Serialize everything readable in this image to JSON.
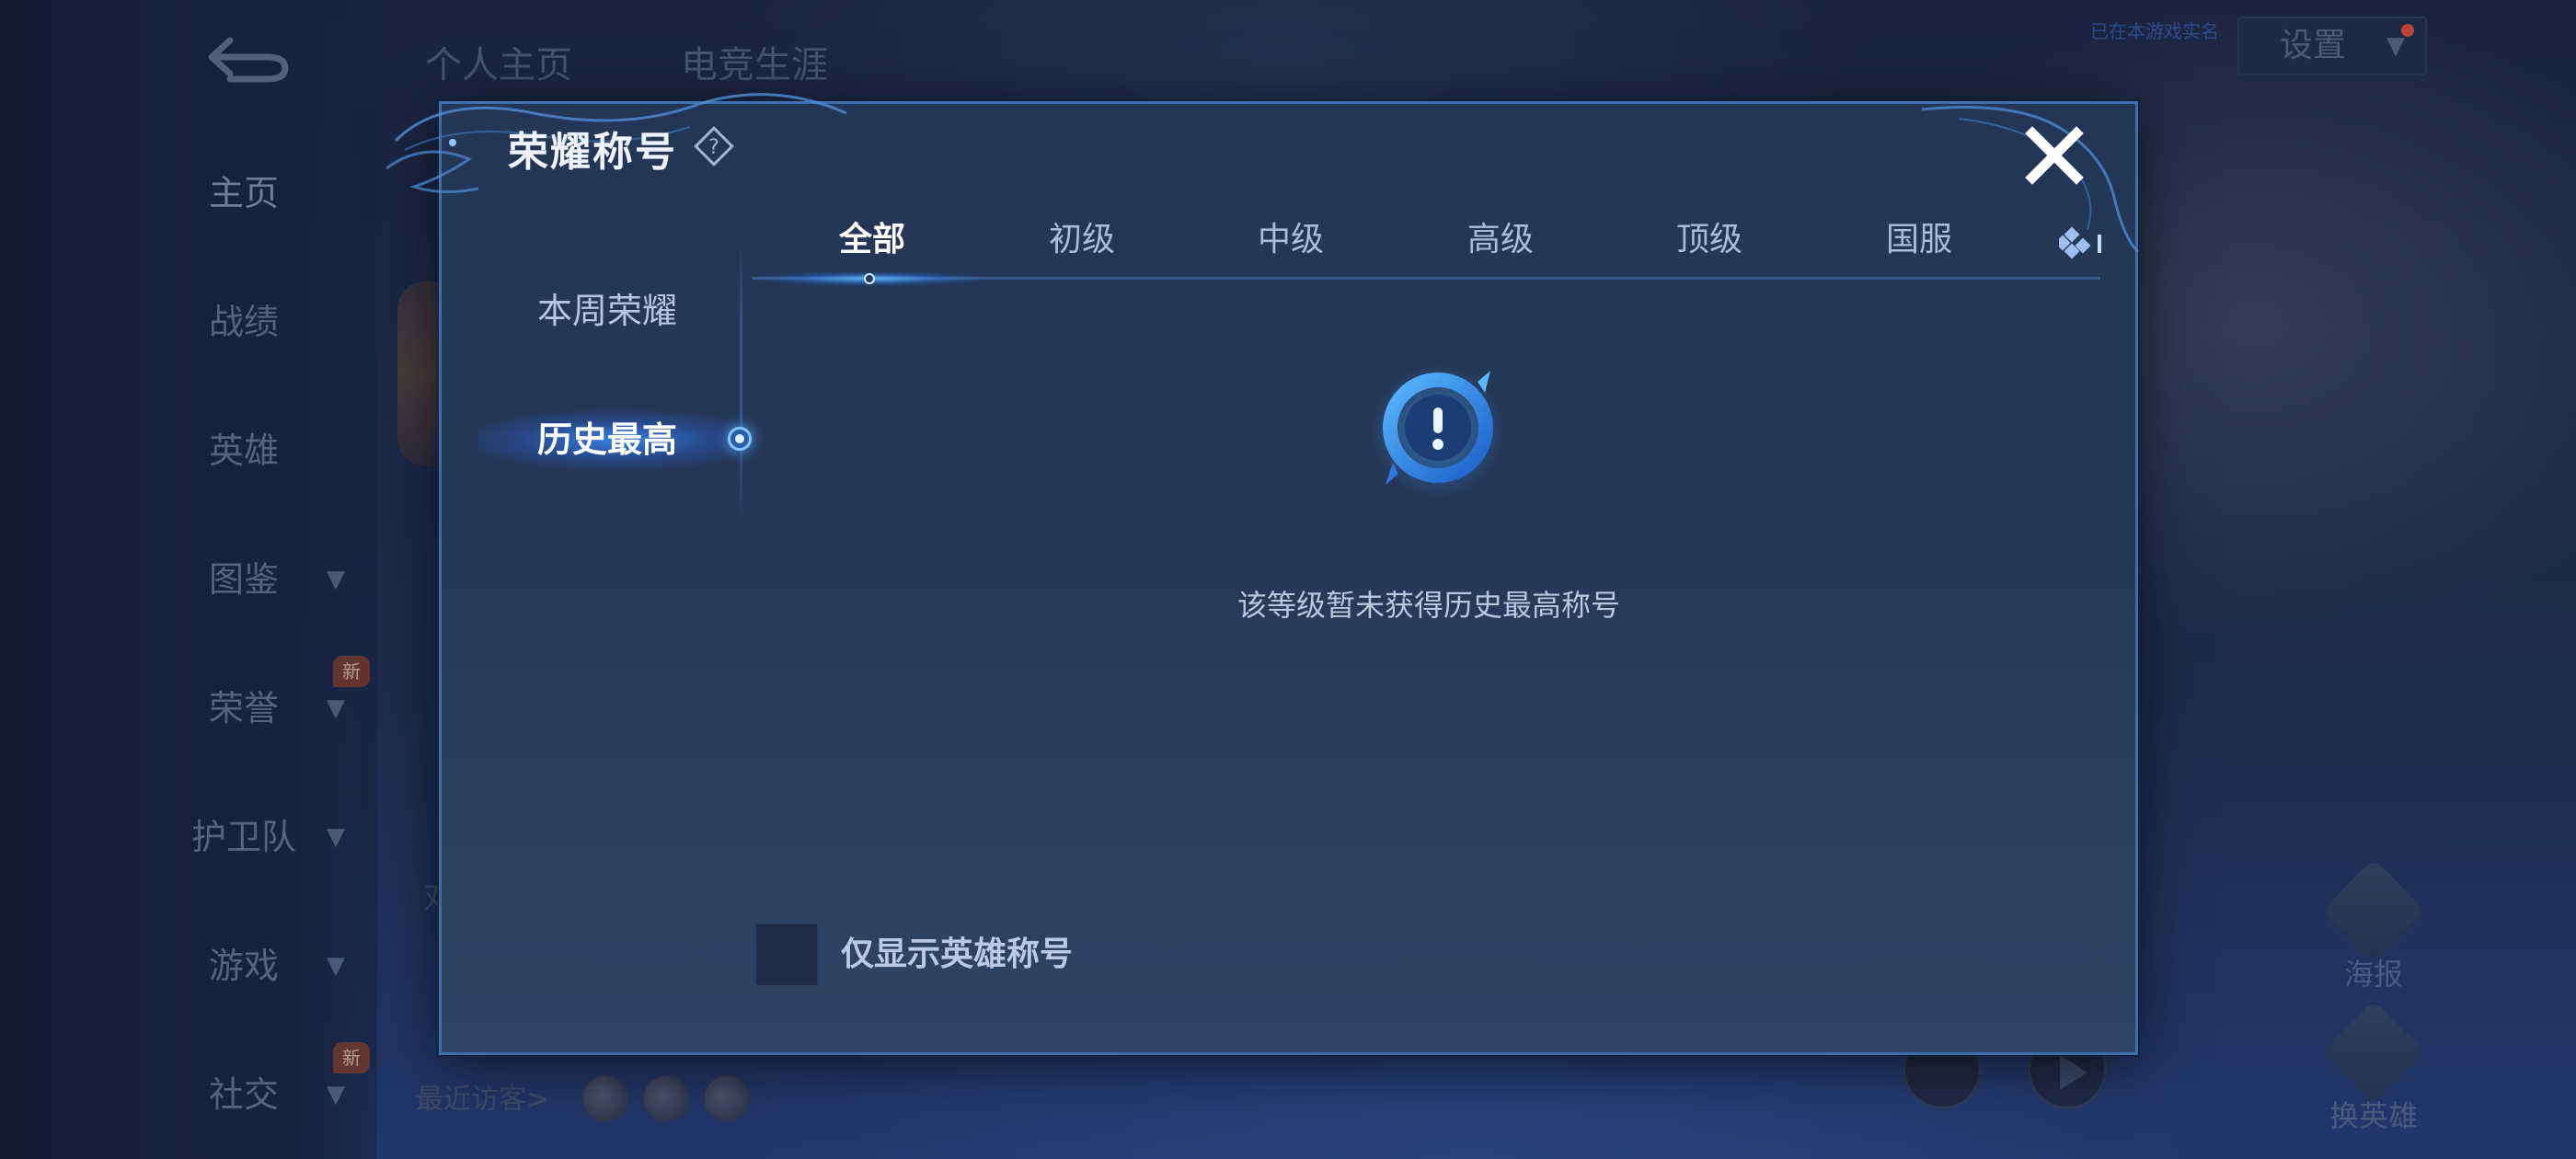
{
  "background": {
    "back_label": "",
    "top_tabs": [
      "个人主页",
      "电竞生涯"
    ],
    "status_text": "已在本游戏实名",
    "settings_label": "设置",
    "nav_items": [
      {
        "label": "主页"
      },
      {
        "label": "战绩"
      },
      {
        "label": "英雄"
      },
      {
        "label": "图鉴"
      },
      {
        "label": "荣誉"
      },
      {
        "label": "护卫队"
      },
      {
        "label": "游戏"
      },
      {
        "label": "社交"
      }
    ],
    "new_badge": "新",
    "partial_text": "对",
    "recent_visitors": "最近访客>",
    "right_actions": [
      {
        "label": "海报"
      },
      {
        "label": "换英雄"
      }
    ]
  },
  "modal": {
    "title": "荣耀称号",
    "side_tabs": [
      {
        "label": "本周荣耀",
        "active": false
      },
      {
        "label": "历史最高",
        "active": true
      }
    ],
    "level_tabs": [
      {
        "label": "全部",
        "active": true
      },
      {
        "label": "初级",
        "active": false
      },
      {
        "label": "中级",
        "active": false
      },
      {
        "label": "高级",
        "active": false
      },
      {
        "label": "顶级",
        "active": false
      },
      {
        "label": "国服",
        "active": false
      }
    ],
    "empty_message": "该等级暂未获得历史最高称号",
    "checkbox_label": "仅显示英雄称号",
    "checkbox_checked": false
  },
  "colors": {
    "accent": "#3a8cff",
    "modal_border": "#3d6fae",
    "badge": "#7d3b2a"
  }
}
